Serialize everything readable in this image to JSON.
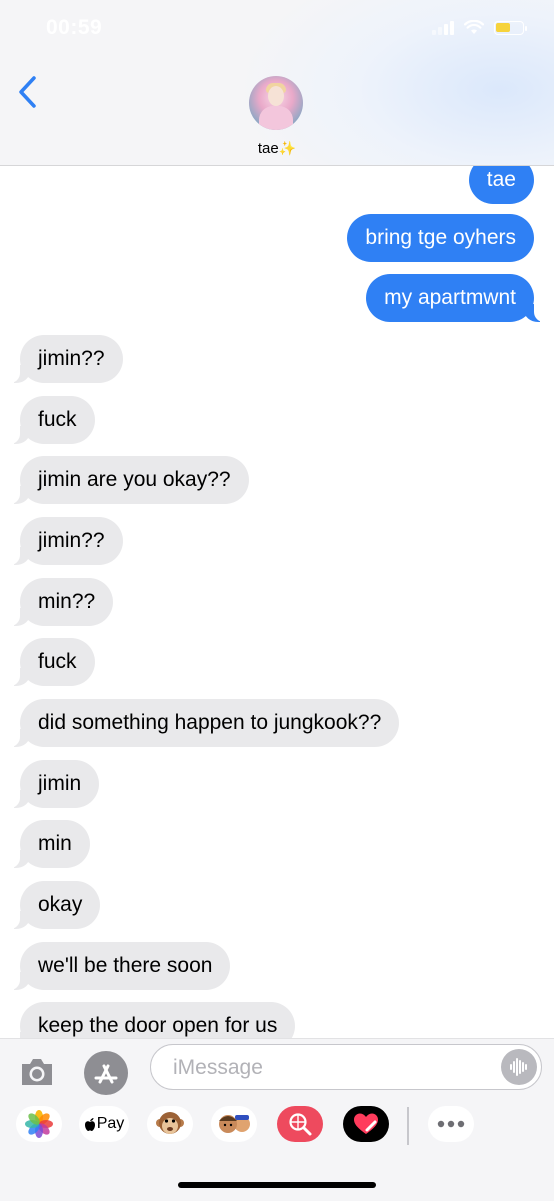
{
  "status_bar": {
    "time": "00:59",
    "battery_color": "#f6d33c"
  },
  "header": {
    "contact_name": "tae",
    "contact_emoji": "✨",
    "back_icon": "chevron-left-icon"
  },
  "messages": [
    {
      "from": "me",
      "text": "tae"
    },
    {
      "from": "me",
      "text": "bring tge oyhers"
    },
    {
      "from": "me",
      "text": "my apartmwnt"
    },
    {
      "from": "them",
      "text": "jimin??"
    },
    {
      "from": "them",
      "text": "fuck"
    },
    {
      "from": "them",
      "text": "jimin are you okay??"
    },
    {
      "from": "them",
      "text": "jimin??"
    },
    {
      "from": "them",
      "text": "min??"
    },
    {
      "from": "them",
      "text": "fuck"
    },
    {
      "from": "them",
      "text": "did something happen to jungkook??"
    },
    {
      "from": "them",
      "text": "jimin"
    },
    {
      "from": "them",
      "text": "min"
    },
    {
      "from": "them",
      "text": "okay"
    },
    {
      "from": "them",
      "text": "we'll be there soon"
    },
    {
      "from": "them",
      "text": "keep the door open for us"
    }
  ],
  "composer": {
    "placeholder": "iMessage"
  },
  "app_drawer": [
    {
      "name": "photos-app-icon"
    },
    {
      "name": "apple-pay-app-icon",
      "label": "Pay"
    },
    {
      "name": "animoji-monkey-icon"
    },
    {
      "name": "memoji-icon"
    },
    {
      "name": "images-search-icon"
    },
    {
      "name": "digital-touch-heart-icon"
    },
    {
      "name": "more-apps-icon"
    }
  ],
  "colors": {
    "sent_bubble": "#2f80f4",
    "received_bubble": "#e9e9eb",
    "accent": "#2f80f4"
  }
}
